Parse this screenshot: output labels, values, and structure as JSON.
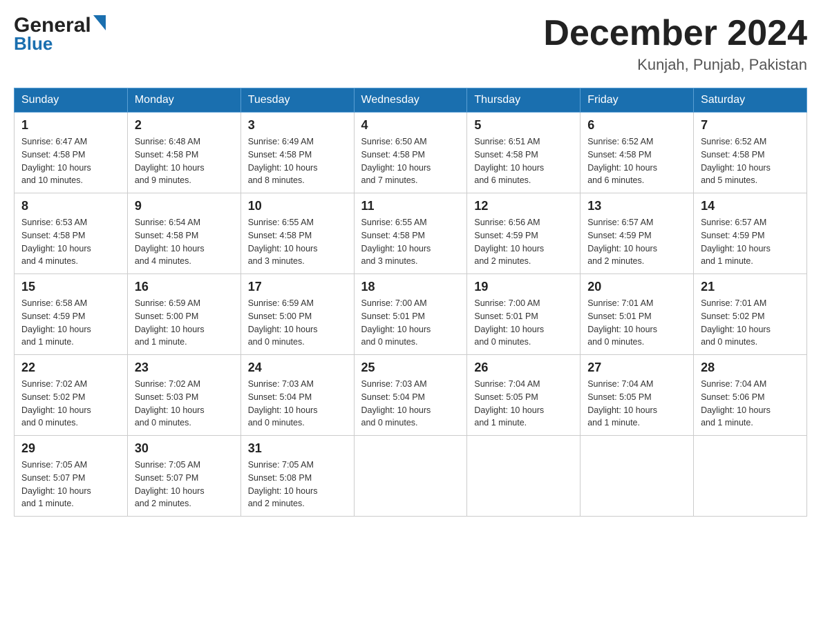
{
  "header": {
    "logo_line1": "General",
    "logo_line2": "Blue",
    "month_title": "December 2024",
    "location": "Kunjah, Punjab, Pakistan"
  },
  "days_of_week": [
    "Sunday",
    "Monday",
    "Tuesday",
    "Wednesday",
    "Thursday",
    "Friday",
    "Saturday"
  ],
  "weeks": [
    [
      {
        "day": "1",
        "sunrise": "6:47 AM",
        "sunset": "4:58 PM",
        "daylight": "10 hours and 10 minutes."
      },
      {
        "day": "2",
        "sunrise": "6:48 AM",
        "sunset": "4:58 PM",
        "daylight": "10 hours and 9 minutes."
      },
      {
        "day": "3",
        "sunrise": "6:49 AM",
        "sunset": "4:58 PM",
        "daylight": "10 hours and 8 minutes."
      },
      {
        "day": "4",
        "sunrise": "6:50 AM",
        "sunset": "4:58 PM",
        "daylight": "10 hours and 7 minutes."
      },
      {
        "day": "5",
        "sunrise": "6:51 AM",
        "sunset": "4:58 PM",
        "daylight": "10 hours and 6 minutes."
      },
      {
        "day": "6",
        "sunrise": "6:52 AM",
        "sunset": "4:58 PM",
        "daylight": "10 hours and 6 minutes."
      },
      {
        "day": "7",
        "sunrise": "6:52 AM",
        "sunset": "4:58 PM",
        "daylight": "10 hours and 5 minutes."
      }
    ],
    [
      {
        "day": "8",
        "sunrise": "6:53 AM",
        "sunset": "4:58 PM",
        "daylight": "10 hours and 4 minutes."
      },
      {
        "day": "9",
        "sunrise": "6:54 AM",
        "sunset": "4:58 PM",
        "daylight": "10 hours and 4 minutes."
      },
      {
        "day": "10",
        "sunrise": "6:55 AM",
        "sunset": "4:58 PM",
        "daylight": "10 hours and 3 minutes."
      },
      {
        "day": "11",
        "sunrise": "6:55 AM",
        "sunset": "4:58 PM",
        "daylight": "10 hours and 3 minutes."
      },
      {
        "day": "12",
        "sunrise": "6:56 AM",
        "sunset": "4:59 PM",
        "daylight": "10 hours and 2 minutes."
      },
      {
        "day": "13",
        "sunrise": "6:57 AM",
        "sunset": "4:59 PM",
        "daylight": "10 hours and 2 minutes."
      },
      {
        "day": "14",
        "sunrise": "6:57 AM",
        "sunset": "4:59 PM",
        "daylight": "10 hours and 1 minute."
      }
    ],
    [
      {
        "day": "15",
        "sunrise": "6:58 AM",
        "sunset": "4:59 PM",
        "daylight": "10 hours and 1 minute."
      },
      {
        "day": "16",
        "sunrise": "6:59 AM",
        "sunset": "5:00 PM",
        "daylight": "10 hours and 1 minute."
      },
      {
        "day": "17",
        "sunrise": "6:59 AM",
        "sunset": "5:00 PM",
        "daylight": "10 hours and 0 minutes."
      },
      {
        "day": "18",
        "sunrise": "7:00 AM",
        "sunset": "5:01 PM",
        "daylight": "10 hours and 0 minutes."
      },
      {
        "day": "19",
        "sunrise": "7:00 AM",
        "sunset": "5:01 PM",
        "daylight": "10 hours and 0 minutes."
      },
      {
        "day": "20",
        "sunrise": "7:01 AM",
        "sunset": "5:01 PM",
        "daylight": "10 hours and 0 minutes."
      },
      {
        "day": "21",
        "sunrise": "7:01 AM",
        "sunset": "5:02 PM",
        "daylight": "10 hours and 0 minutes."
      }
    ],
    [
      {
        "day": "22",
        "sunrise": "7:02 AM",
        "sunset": "5:02 PM",
        "daylight": "10 hours and 0 minutes."
      },
      {
        "day": "23",
        "sunrise": "7:02 AM",
        "sunset": "5:03 PM",
        "daylight": "10 hours and 0 minutes."
      },
      {
        "day": "24",
        "sunrise": "7:03 AM",
        "sunset": "5:04 PM",
        "daylight": "10 hours and 0 minutes."
      },
      {
        "day": "25",
        "sunrise": "7:03 AM",
        "sunset": "5:04 PM",
        "daylight": "10 hours and 0 minutes."
      },
      {
        "day": "26",
        "sunrise": "7:04 AM",
        "sunset": "5:05 PM",
        "daylight": "10 hours and 1 minute."
      },
      {
        "day": "27",
        "sunrise": "7:04 AM",
        "sunset": "5:05 PM",
        "daylight": "10 hours and 1 minute."
      },
      {
        "day": "28",
        "sunrise": "7:04 AM",
        "sunset": "5:06 PM",
        "daylight": "10 hours and 1 minute."
      }
    ],
    [
      {
        "day": "29",
        "sunrise": "7:05 AM",
        "sunset": "5:07 PM",
        "daylight": "10 hours and 1 minute."
      },
      {
        "day": "30",
        "sunrise": "7:05 AM",
        "sunset": "5:07 PM",
        "daylight": "10 hours and 2 minutes."
      },
      {
        "day": "31",
        "sunrise": "7:05 AM",
        "sunset": "5:08 PM",
        "daylight": "10 hours and 2 minutes."
      },
      null,
      null,
      null,
      null
    ]
  ],
  "labels": {
    "sunrise": "Sunrise:",
    "sunset": "Sunset:",
    "daylight": "Daylight:"
  }
}
